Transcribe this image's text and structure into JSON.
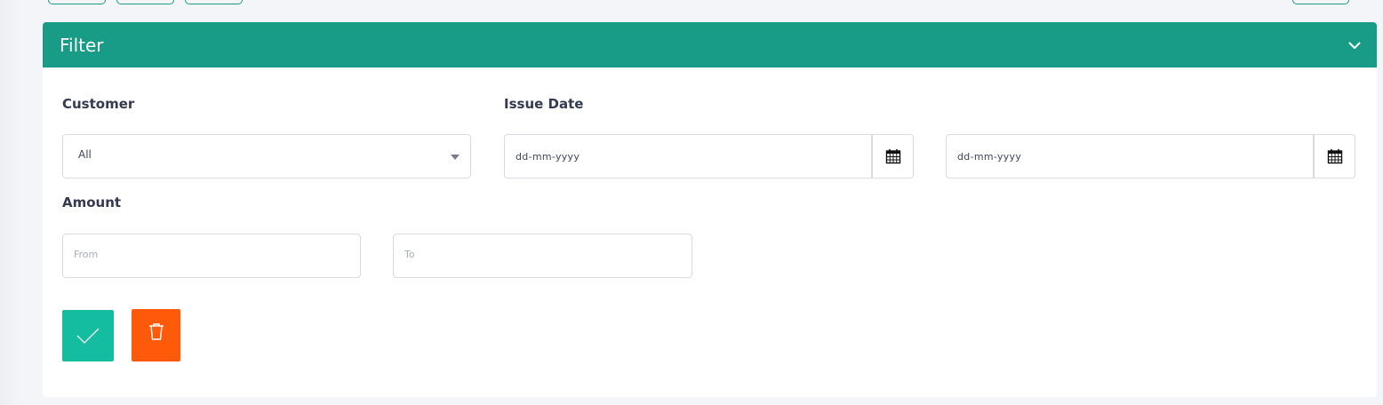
{
  "filter": {
    "title": "Filter",
    "collapse_icon": "chevron-down-icon"
  },
  "customer": {
    "label": "Customer",
    "selected": "All"
  },
  "issue_date": {
    "label": "Issue Date",
    "from_placeholder": "dd-mm-yyyy",
    "to_placeholder": "dd-mm-yyyy",
    "calendar_icon": "calendar-icon"
  },
  "amount": {
    "label": "Amount",
    "from_placeholder": "From",
    "to_placeholder": "To"
  },
  "actions": {
    "apply_icon": "check-icon",
    "clear_icon": "trash-icon"
  },
  "colors": {
    "header": "#189b87",
    "apply": "#14bca0",
    "clear": "#ff5a0a"
  }
}
